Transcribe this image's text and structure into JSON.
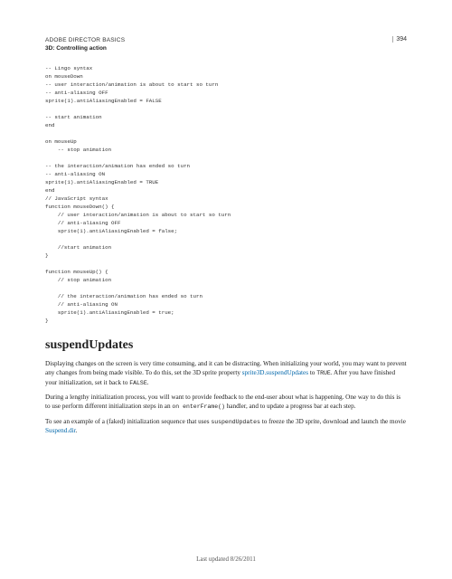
{
  "header": {
    "title": "ADOBE DIRECTOR BASICS",
    "chapter": "3D: Controlling action",
    "pageNum": "394"
  },
  "code": "-- Lingo syntax\non mouseDown\n-- user interaction/animation is about to start so turn\n-- anti-aliasing OFF\nsprite(1).antiAliasingEnabled = FALSE\n\n-- start animation\nend\n\non mouseUp\n    -- stop animation\n\n-- the interaction/animation has ended so turn\n-- anti-aliasing ON\nsprite(1).antiAliasingEnabled = TRUE\nend\n// JavaScript syntax\nfunction mouseDown() {\n    // user interaction/animation is about to start so turn\n    // anti-aliasing OFF\n    sprite(1).antiAliasingEnabled = false;\n\n    //start animation\n}\n\nfunction mouseUp() {\n    // stop animation\n\n    // the interaction/animation has ended so turn\n    // anti-aliasing ON\n    sprite(1).antiAliasingEnabled = true;\n}",
  "section": {
    "title": "suspendUpdates",
    "p1a": "Displaying changes on the screen is very time consuming, and it can be distracting. When initializing your world, you may want to prevent any changes from being made visible. To do this, set the 3D sprite property ",
    "p1link": "sprite3D.suspendUpdates",
    "p1b": " to ",
    "p1true": "TRUE",
    "p1c": ". After you have finished your initialization, set it back to ",
    "p1false": "FALSE",
    "p1d": ".",
    "p2a": "During a lengthy initialization process, you will want to provide feedback to the end-user about what is happening. One way to do this is to use perform different initialization steps in an ",
    "p2mono": "on enterFrame()",
    "p2b": " handler, and to update a progress bar at each step.",
    "p3a": "To see an example of a (faked) initialization sequence that uses ",
    "p3mono": "suspendUpdates",
    "p3b": " to freeze the 3D sprite, download and launch the movie ",
    "p3link": "Suspend.dir",
    "p3c": "."
  },
  "footer": "Last updated 8/26/2011"
}
